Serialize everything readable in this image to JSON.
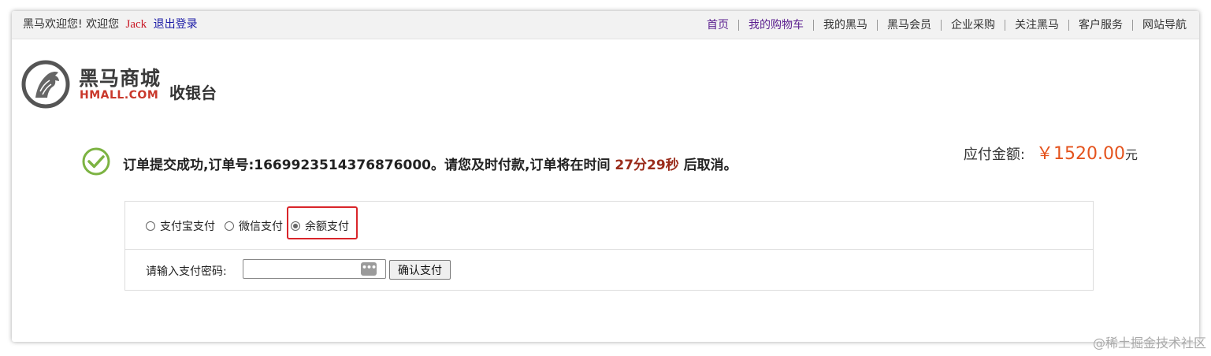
{
  "topbar": {
    "welcome": "黑马欢迎您!",
    "greeting": "欢迎您",
    "username": "Jack",
    "logout": "退出登录",
    "nav": [
      "首页",
      "我的购物车",
      "我的黑马",
      "黑马会员",
      "企业采购",
      "关注黑马",
      "客户服务",
      "网站导航"
    ]
  },
  "logo": {
    "cn": "黑马商城",
    "en": "HMALL.COM",
    "page_title": "收银台"
  },
  "order": {
    "message_prefix": "订单提交成功,订单号:1669923514376876000。请您及时付款,订单将在时间",
    "countdown": "27分29秒",
    "message_suffix": "后取消。"
  },
  "payment": {
    "amount_label": "应付金额:",
    "amount": "￥1520.00",
    "currency_unit": "元",
    "methods": [
      {
        "label": "支付宝支付",
        "selected": false
      },
      {
        "label": "微信支付",
        "selected": false
      },
      {
        "label": "余额支付",
        "selected": true
      }
    ],
    "password_label": "请输入支付密码:",
    "password_value": "",
    "password_reveal_glyph": "•••",
    "confirm_label": "确认支付"
  },
  "watermark": "@稀土掘金技术社区",
  "colors": {
    "highlight": "#d9252a",
    "price": "#e4531d",
    "countdown": "#9a2b1a",
    "success": "#7cb342"
  }
}
